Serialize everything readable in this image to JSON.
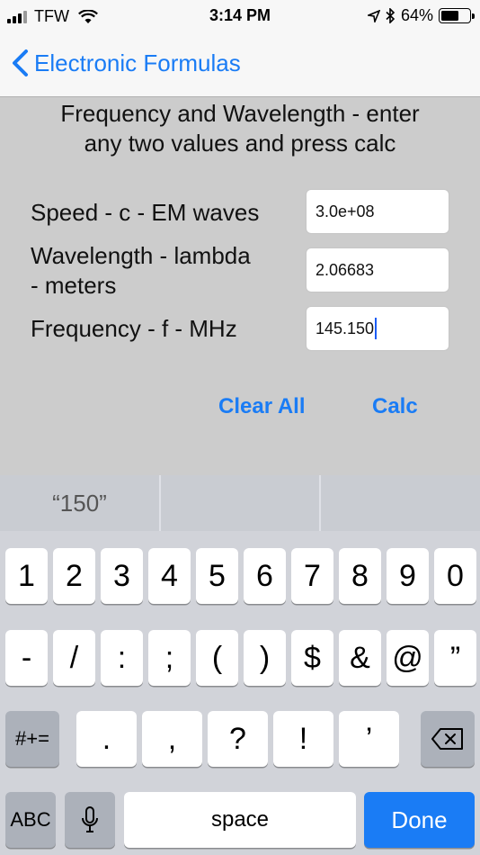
{
  "status_bar": {
    "carrier": "TFW",
    "time": "3:14 PM",
    "battery_percent": "64%"
  },
  "nav": {
    "back_label": "Electronic Formulas"
  },
  "content": {
    "instructions_line1": "Frequency and Wavelength - enter",
    "instructions_line2": "any two values and press calc",
    "fields": [
      {
        "label": "Speed - c - EM waves",
        "value": "3.0e+08"
      },
      {
        "label_line1": "Wavelength - lambda",
        "label_line2": "- meters",
        "value": "2.06683"
      },
      {
        "label": "Frequency - f - MHz",
        "value": "145.150"
      }
    ],
    "clear_label": "Clear All",
    "calc_label": "Calc"
  },
  "keyboard": {
    "suggestion": "“150”",
    "row1": [
      "1",
      "2",
      "3",
      "4",
      "5",
      "6",
      "7",
      "8",
      "9",
      "0"
    ],
    "row2": [
      "-",
      "/",
      ":",
      ";",
      "(",
      ")",
      "$",
      "&",
      "@",
      "”"
    ],
    "row3": [
      ".",
      ",",
      "?",
      "!",
      "’"
    ],
    "symbols_label": "#+=",
    "abc_label": "ABC",
    "space_label": "space",
    "done_label": "Done",
    "accent_color": "#1a7cf5"
  }
}
